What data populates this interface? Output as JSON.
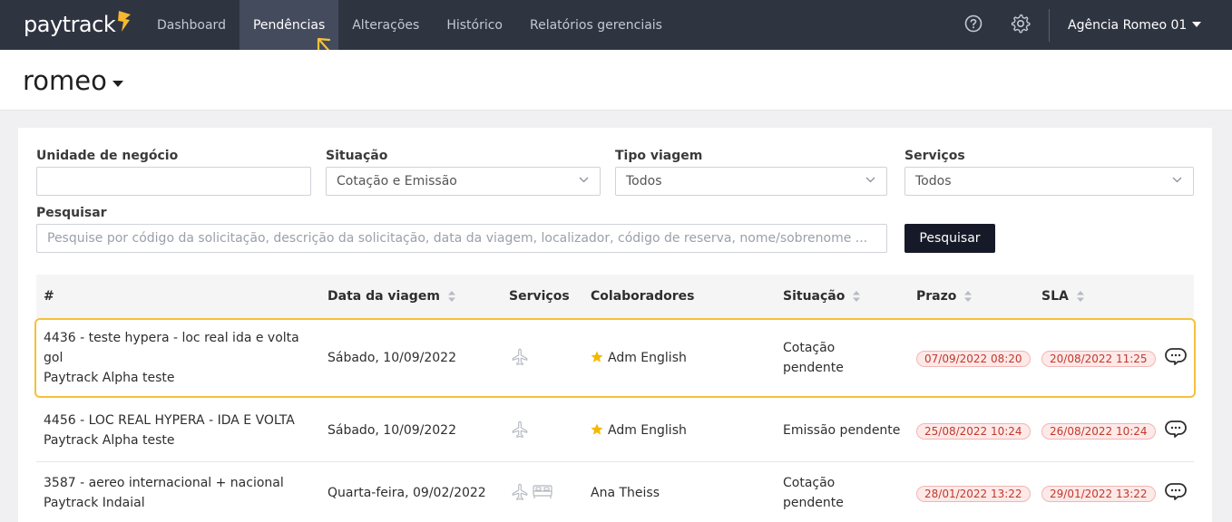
{
  "brand": {
    "part1": "pay",
    "part2": "track"
  },
  "nav": {
    "items": [
      {
        "label": "Dashboard"
      },
      {
        "label": "Pendências"
      },
      {
        "label": "Alterações"
      },
      {
        "label": "Histórico"
      },
      {
        "label": "Relatórios gerenciais"
      }
    ],
    "active_index": 1,
    "agency": "Agência Romeo 01",
    "help_icon": "help-circle-icon",
    "settings_icon": "gear-icon"
  },
  "page": {
    "title": "romeo"
  },
  "filters": {
    "unit_label": "Unidade de negócio",
    "unit_value": "",
    "situation_label": "Situação",
    "situation_value": "Cotação e Emissão",
    "trip_type_label": "Tipo viagem",
    "trip_type_value": "Todos",
    "services_label": "Serviços",
    "services_value": "Todos",
    "search_label": "Pesquisar",
    "search_placeholder": "Pesquise por código da solicitação, descrição da solicitação, data da viagem, localizador, código de reserva, nome/sobrenome ...",
    "search_button": "Pesquisar"
  },
  "table": {
    "headers": {
      "id": "#",
      "date": "Data da viagem",
      "services": "Serviços",
      "collaborators": "Colaboradores",
      "situation": "Situação",
      "deadline": "Prazo",
      "sla": "SLA"
    },
    "rows": [
      {
        "title_line1": "4436 - teste hypera - loc real ida e volta",
        "title_line2": "gol",
        "company": "Paytrack Alpha teste",
        "date": "Sábado, 10/09/2022",
        "services": [
          "plane-icon"
        ],
        "collaborator": "Adm English",
        "starred": true,
        "situation_line1": "Cotação",
        "situation_line2": "pendente",
        "deadline": "07/09/2022 08:20",
        "sla": "20/08/2022 11:25"
      },
      {
        "title_line1": "4456 - LOC REAL HYPERA - IDA E VOLTA",
        "company": "Paytrack Alpha teste",
        "date": "Sábado, 10/09/2022",
        "services": [
          "plane-icon"
        ],
        "collaborator": "Adm English",
        "starred": true,
        "situation_line1": "Emissão pendente",
        "deadline": "25/08/2022 10:24",
        "sla": "26/08/2022 10:24"
      },
      {
        "title_line1": "3587 - aereo internacional + nacional",
        "company": "Paytrack Indaial",
        "date": "Quarta-feira, 09/02/2022",
        "services": [
          "plane-icon",
          "hotel-bed-icon"
        ],
        "collaborator": "Ana Theiss",
        "starred": false,
        "situation_line1": "Cotação",
        "situation_line2": "pendente",
        "deadline": "28/01/2022 13:22",
        "sla": "29/01/2022 13:22"
      }
    ]
  },
  "colors": {
    "topbar": "#2f3441",
    "active_tab": "#444b5c",
    "highlight": "#f5c13a",
    "badge_bg": "#fde9e8",
    "badge_text": "#c0392b",
    "star": "#f5b800",
    "button": "#161a28"
  }
}
